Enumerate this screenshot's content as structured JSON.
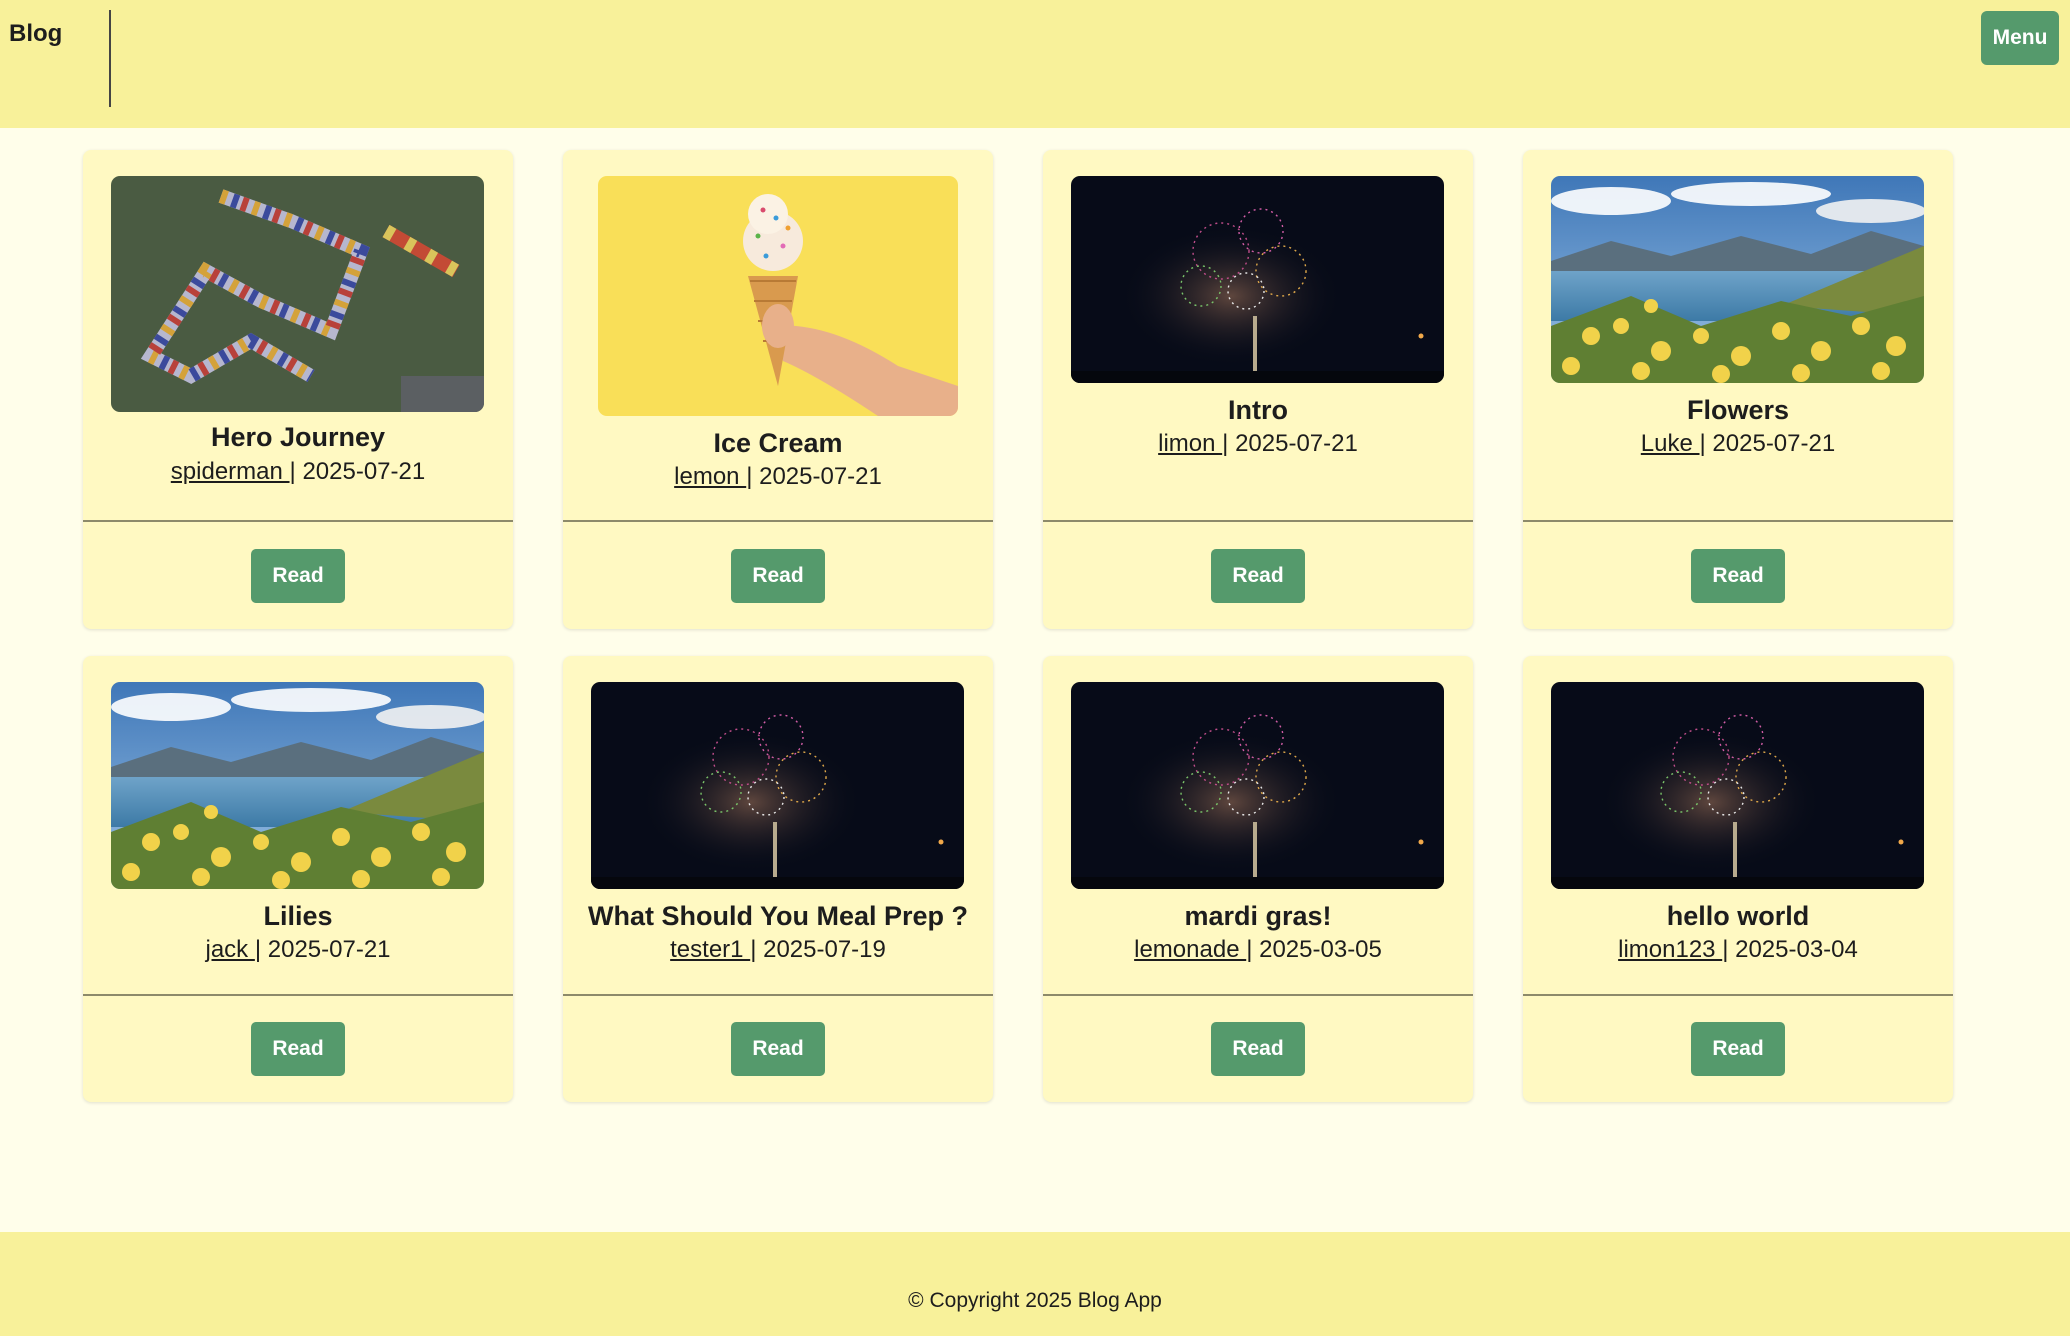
{
  "navbar": {
    "brand": "Blog",
    "menu_label": "Menu",
    "background_color": "#f8f19a",
    "button_color": "#559a6c"
  },
  "posts": [
    {
      "title": "Hero Journey",
      "author": "spiderman ",
      "separator": "| ",
      "date": "2025-07-21",
      "read_label": "Read",
      "image": "maze-track-image"
    },
    {
      "title": "Ice Cream",
      "author": "lemon ",
      "separator": "| ",
      "date": "2025-07-21",
      "read_label": "Read",
      "image": "ice-cream-cone-image"
    },
    {
      "title": "Intro",
      "author": "limon ",
      "separator": "| ",
      "date": "2025-07-21",
      "read_label": "Read",
      "image": "fireworks-image"
    },
    {
      "title": "Flowers",
      "author": "Luke ",
      "separator": "| ",
      "date": "2025-07-21",
      "read_label": "Read",
      "image": "lake-flowers-image"
    },
    {
      "title": "Lilies",
      "author": "jack ",
      "separator": "| ",
      "date": "2025-07-21",
      "read_label": "Read",
      "image": "lake-flowers-image"
    },
    {
      "title": "What Should You Meal Prep ?",
      "author": "tester1 ",
      "separator": "| ",
      "date": "2025-07-19",
      "read_label": "Read",
      "image": "fireworks-image"
    },
    {
      "title": "mardi gras!",
      "author": "lemonade ",
      "separator": "| ",
      "date": "2025-03-05",
      "read_label": "Read",
      "image": "fireworks-image"
    },
    {
      "title": "hello world",
      "author": "limon123 ",
      "separator": "| ",
      "date": "2025-03-04",
      "read_label": "Read",
      "image": "fireworks-image"
    }
  ],
  "footer": {
    "text": "© Copyright 2025 Blog App"
  }
}
